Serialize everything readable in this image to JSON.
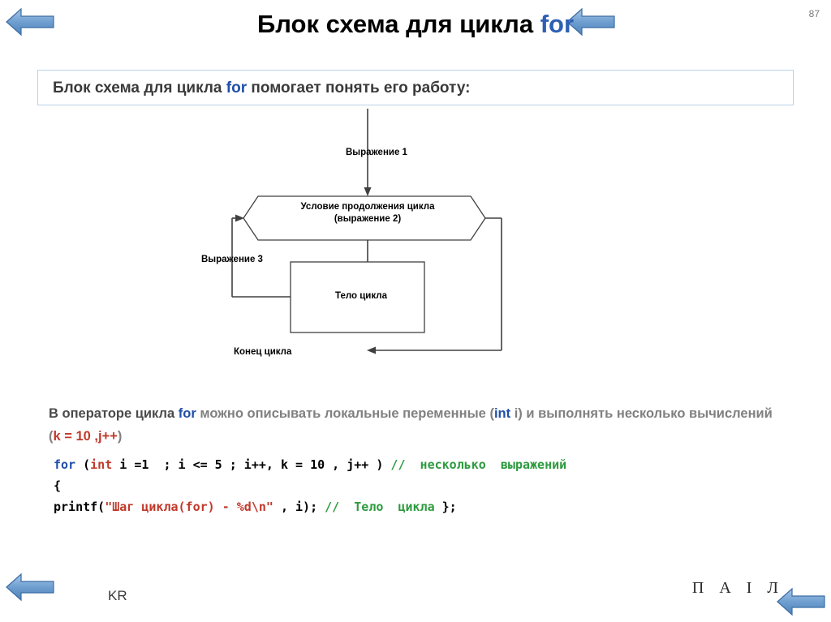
{
  "slide": {
    "page_number": "87",
    "title_prefix": "Блок схема для цикла ",
    "title_keyword": "for",
    "subtitle_pre": "Блок схема для цикла ",
    "subtitle_keyword": "for",
    "subtitle_post": " помогает понять его работу:",
    "footer_left": "KR",
    "footer_right": "П А І Л"
  },
  "nav": {
    "top_left_icon": "arrow-left-icon",
    "top_right_icon": "arrow-left-icon",
    "bottom_left_icon": "arrow-left-icon",
    "bottom_right_icon": "arrow-left-icon"
  },
  "flowchart": {
    "label_expression_1": "Выражение 1",
    "label_expression_3": "Выражение 3",
    "label_loop_end": "Конец цикла",
    "condition_line_1": "Условие продолжения цикла",
    "condition_line_2": "(выражение 2)",
    "body_text": "Тело цикла",
    "colors": {
      "stroke": "#404040",
      "fill": "#ffffff"
    }
  },
  "paragraph": {
    "part1": "В операторе цикла ",
    "kw1": "for",
    "part2": " можно описывать локальные переменные (",
    "kw2": "int",
    "part3": " i) и выполнять несколько вычислений (",
    "kw3": "k = 10 ,j++",
    "part4": ")"
  },
  "code": {
    "line1": [
      {
        "text": "for ",
        "style": "blue"
      },
      {
        "text": "(",
        "style": "plain"
      },
      {
        "text": "int",
        "style": "red"
      },
      {
        "text": " i =1  ; i <= 5 ; i++, k = 10 , j++ ) ",
        "style": "plain"
      },
      {
        "text": "//  несколько  выражений",
        "style": "green"
      }
    ],
    "line2": [
      {
        "text": "{",
        "style": "plain"
      }
    ],
    "line3": [
      {
        "text": "printf(",
        "style": "plain"
      },
      {
        "text": "\"Шаг цикла(for) - %d\\n\"",
        "style": "red"
      },
      {
        "text": " , i); ",
        "style": "plain"
      },
      {
        "text": "//  Тело  цикла ",
        "style": "green"
      },
      {
        "text": "};",
        "style": "plain"
      }
    ]
  }
}
